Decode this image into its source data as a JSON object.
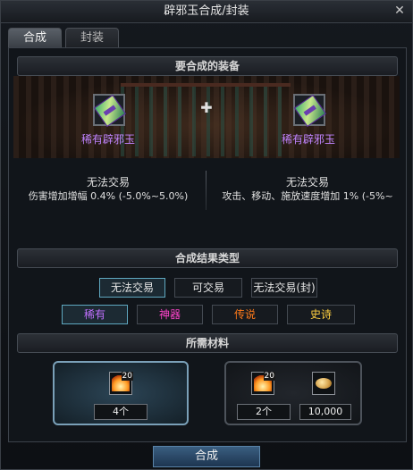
{
  "window": {
    "title": "辟邪玉合成/封装",
    "close_glyph": "✕"
  },
  "tabs": [
    {
      "label": "合成",
      "active": true
    },
    {
      "label": "封装",
      "active": false
    }
  ],
  "equip_section": {
    "header": "要合成的装备",
    "left_item": {
      "name": "稀有辟邪玉",
      "icon": "jade-amulet-icon"
    },
    "right_item": {
      "name": "稀有辟邪玉",
      "icon": "jade-amulet-icon"
    },
    "plus_glyph": "✚",
    "left_stats": {
      "trade": "无法交易",
      "effect": "伤害增加增幅 0.4% (-5.0%~5.0%)"
    },
    "right_stats": {
      "trade": "无法交易",
      "effect": "攻击、移动、施放速度增加 1% (-5%~"
    }
  },
  "result_section": {
    "header": "合成结果类型",
    "trade_options": [
      {
        "label": "无法交易",
        "selected": true
      },
      {
        "label": "可交易",
        "selected": false
      },
      {
        "label": "无法交易(封)",
        "selected": false
      }
    ],
    "rarity_options": [
      {
        "label": "稀有",
        "color": "#c070ff",
        "selected": true
      },
      {
        "label": "神器",
        "color": "#ff44cc",
        "selected": false
      },
      {
        "label": "传说",
        "color": "#ff7a1a",
        "selected": false
      },
      {
        "label": "史诗",
        "color": "#ffd040",
        "selected": false
      }
    ]
  },
  "materials_section": {
    "header": "所需材料",
    "option_a": {
      "icon": "flame-orb-icon",
      "level": "20",
      "count": "4个",
      "selected": true
    },
    "option_b": {
      "icon": "flame-orb-icon",
      "level": "20",
      "count": "2个",
      "gold_icon": "gold-coins-icon",
      "gold": "10,000",
      "selected": false
    }
  },
  "confirm_button": {
    "label": "合成"
  },
  "colors": {
    "rare_purple": "#c084ff",
    "selected_border": "#5fa8c0",
    "confirm_blue": "#3a5e80"
  }
}
